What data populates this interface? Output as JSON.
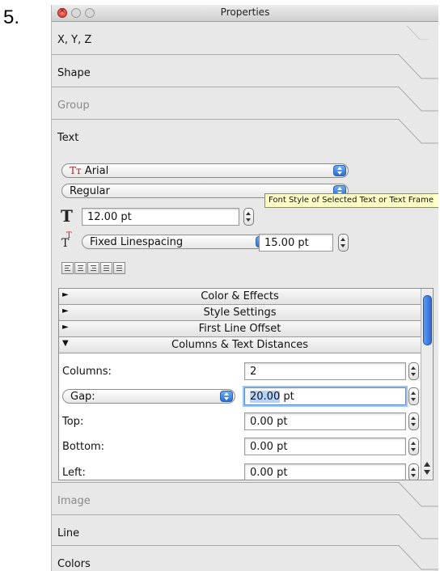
{
  "step_number": "5.",
  "window": {
    "title": "Properties"
  },
  "sections": {
    "xyz": "X, Y, Z",
    "shape": "Shape",
    "group": "Group",
    "text": "Text",
    "image": "Image",
    "line": "Line",
    "colors": "Colors"
  },
  "text_panel": {
    "font_family": "Arial",
    "font_family_glyph": "Tт",
    "font_style": "Regular",
    "tooltip": "Font Style of Selected Text or Text Frame",
    "font_size": "12.00 pt",
    "font_size_glyph": "T",
    "linespacing_glyph": "T",
    "linespacing_mode": "Fixed Linespacing",
    "linespacing_value": "15.00 pt"
  },
  "subsections": [
    {
      "label": "Color & Effects",
      "expanded": false
    },
    {
      "label": "Style Settings",
      "expanded": false
    },
    {
      "label": "First Line Offset",
      "expanded": false
    },
    {
      "label": "Columns & Text Distances",
      "expanded": true
    }
  ],
  "disclosure": {
    "collapsed": "►",
    "expanded": "▼"
  },
  "columns_panel": {
    "columns_label": "Columns:",
    "columns_value": "2",
    "gap_label": "Gap:",
    "gap_value_selected": "20.00",
    "gap_unit": " pt",
    "top_label": "Top:",
    "top_value": "0.00 pt",
    "bottom_label": "Bottom:",
    "bottom_value": "0.00 pt",
    "left_label": "Left:",
    "left_value": "0.00 pt"
  }
}
